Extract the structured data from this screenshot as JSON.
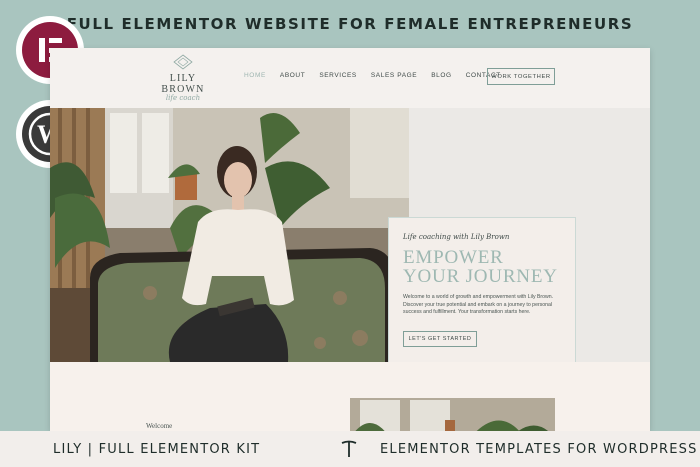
{
  "banner": {
    "title": "FULL ELEMENTOR WEBSITE FOR FEMALE ENTREPRENEURS"
  },
  "badges": {
    "elementor_icon": "elementor-logo-icon",
    "wordpress_icon": "wordpress-logo-icon"
  },
  "site": {
    "logo": {
      "name": "LILY BROWN",
      "tagline": "life coach"
    },
    "nav": {
      "items": [
        "HOME",
        "ABOUT",
        "SERVICES",
        "SALES PAGE",
        "BLOG",
        "CONTACT"
      ],
      "active": "HOME",
      "cta": "WORK TOGETHER"
    },
    "hero": {
      "eyebrow": "Life coaching with Lily Brown",
      "headline_1": "EMPOWER",
      "headline_2": "YOUR JOURNEY",
      "body": "Welcome to a world of growth and empowerment with Lily Brown. Discover your true potential and embark on a journey to personal success and fulfillment. Your transformation starts here.",
      "button": "LET'S GET STARTED"
    },
    "section2": {
      "welcome": "Welcome"
    }
  },
  "footer": {
    "left": "LILY | FULL ELEMENTOR KIT",
    "right": "ELEMENTOR TEMPLATES FOR WORDPRESS",
    "brand_icon": "typography-t-logo-icon"
  },
  "colors": {
    "background": "#a9c5bf",
    "accent": "#9eb8b2",
    "elementor": "#8d1c3f",
    "wordpress": "#3a3a3a"
  }
}
